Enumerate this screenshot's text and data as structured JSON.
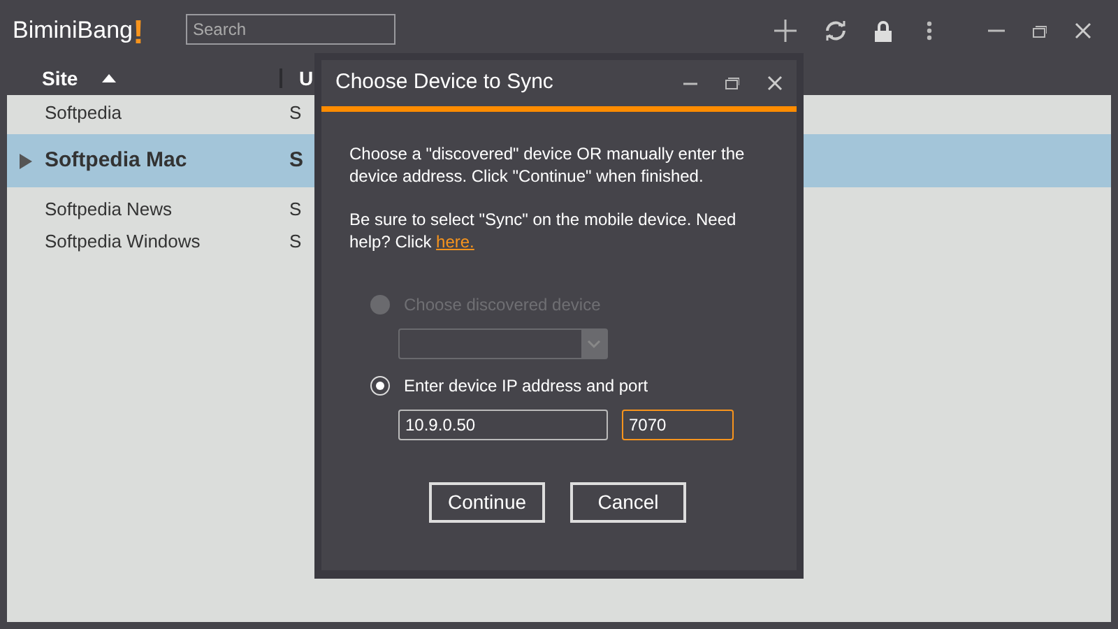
{
  "app": {
    "logo": "BiminiBang",
    "logo_mark": "!",
    "search": {
      "placeholder": "Search"
    }
  },
  "table": {
    "columns": [
      {
        "label": "Site"
      },
      {
        "label": "U"
      }
    ],
    "rows": [
      {
        "cells": [
          "Softpedia",
          "S"
        ],
        "selected": false
      },
      {
        "cells": [
          "Softpedia Mac",
          "S"
        ],
        "selected": true
      },
      {
        "cells": [
          "Softpedia News",
          "S"
        ],
        "selected": false
      },
      {
        "cells": [
          "Softpedia Windows",
          "S"
        ],
        "selected": false
      }
    ]
  },
  "dialog": {
    "title": "Choose Device to Sync",
    "message": "Choose a \"discovered\" device OR manually enter the device address. Click \"Continue\" when finished.",
    "help": "Be sure to select \"Sync\" on the mobile device. Need help? Click ",
    "help_link": "here.",
    "options": [
      {
        "label": "Choose discovered device",
        "selected": false,
        "disabled": true,
        "kind": "dropdown"
      },
      {
        "label": "Enter device IP address and port",
        "selected": true,
        "disabled": false,
        "kind": "address",
        "ip": "10.9.0.50",
        "port": "7070"
      }
    ],
    "buttons": [
      "Continue",
      "Cancel"
    ]
  }
}
